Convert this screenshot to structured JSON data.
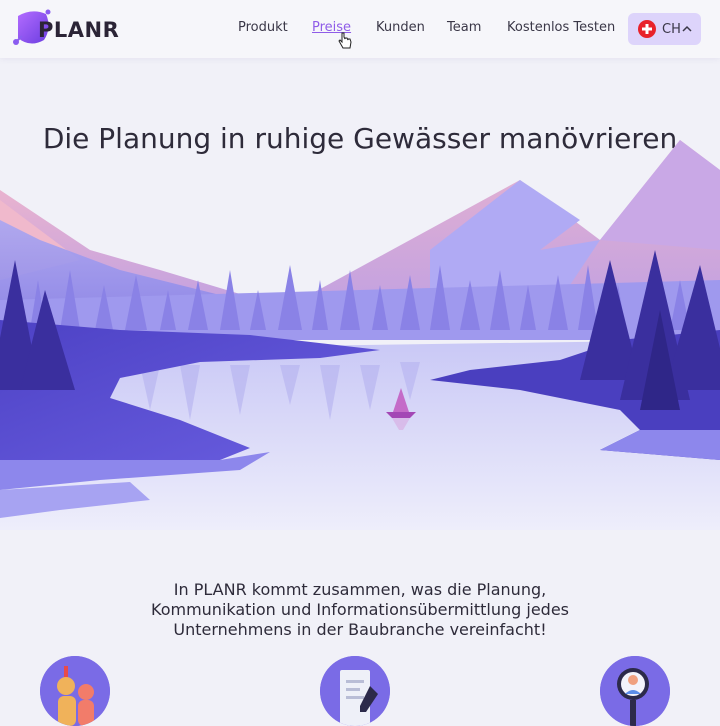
{
  "brand": {
    "logo_text": "PLANR"
  },
  "nav": {
    "items": [
      {
        "label": "Produkt"
      },
      {
        "label": "Preise"
      },
      {
        "label": "Kunden"
      },
      {
        "label": "Team"
      },
      {
        "label": "Kostenlos Testen"
      }
    ]
  },
  "country_selector": {
    "label": "CH",
    "flag_icon": "swiss-flag-icon",
    "chevron_icon": "chevron-up-icon"
  },
  "hero": {
    "title": "Die Planung in ruhige Gewässer manövrieren"
  },
  "tagline": "In PLANR kommt zusammen, was die Planung, Kommunikation und Informationsübermittlung jedes Unternehmens in der Baubranche vereinfacht!",
  "features": [
    {
      "icon": "team-people-icon"
    },
    {
      "icon": "document-pen-icon"
    },
    {
      "icon": "magnifier-person-icon"
    }
  ],
  "colors": {
    "accent": "#8f5ce8",
    "country_bg": "#ddd4fb",
    "flag_red": "#e8222b"
  }
}
